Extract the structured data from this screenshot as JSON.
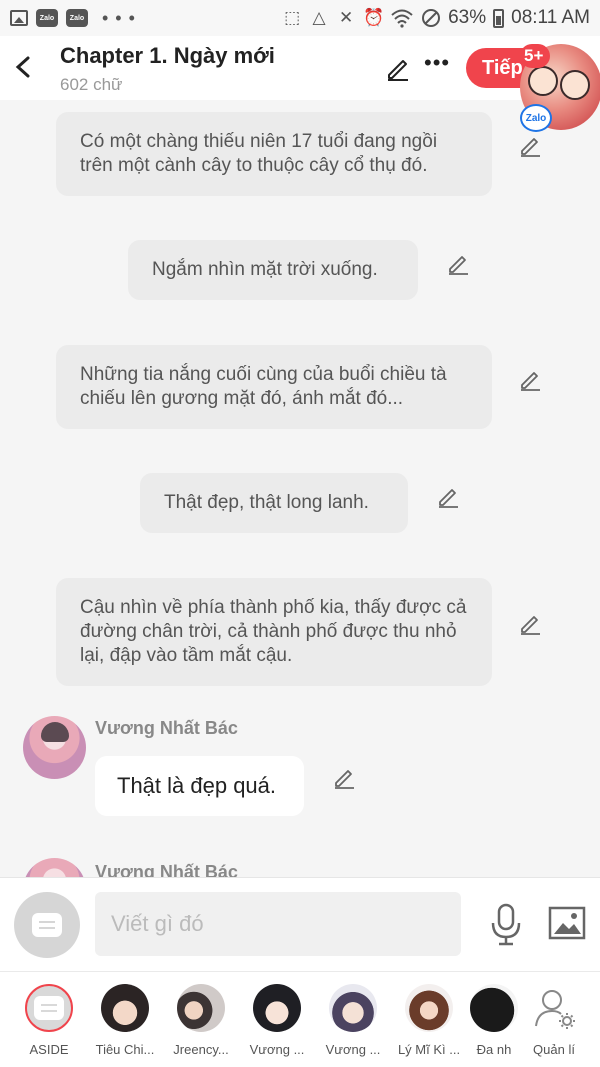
{
  "status_bar": {
    "app_icons": [
      "gallery-icon",
      "zalo-icon",
      "zalo-icon"
    ],
    "battery": "63%",
    "time": "08:11 AM"
  },
  "header": {
    "title": "Chapter 1. Ngày mới",
    "subtitle": "602 chữ",
    "next_label": "Tiếp"
  },
  "chathead": {
    "badge": "5+",
    "app_label": "Zalo"
  },
  "messages": [
    {
      "text": "Có một chàng thiếu niên 17 tuổi đang ngồi trên một cành cây to thuộc cây cổ thụ đó."
    },
    {
      "text": "Ngắm nhìn mặt trời xuống."
    },
    {
      "text": "Những tia nắng cuối cùng của buổi chiều tà chiếu lên gương mặt đó, ánh mắt đó..."
    },
    {
      "text": "Thật đẹp, thật long lanh."
    },
    {
      "text": "Cậu nhìn về phía thành phố kia, thấy được cả đường chân trời, cả thành phố được thu nhỏ lại, đập vào tầm mắt cậu."
    }
  ],
  "dialogue": [
    {
      "sender": "Vương Nhất Bác",
      "text": "Thật là đẹp quá."
    },
    {
      "sender": "Vương Nhất Bác"
    }
  ],
  "composer": {
    "placeholder": "Viết gì đó"
  },
  "characters": [
    {
      "label": "ASIDE"
    },
    {
      "label": "Tiêu Chi..."
    },
    {
      "label": "Jreency..."
    },
    {
      "label": "Vương ..."
    },
    {
      "label": "Vương ..."
    },
    {
      "label": "Lý Mĩ Kì ..."
    },
    {
      "label": "Đa nh"
    },
    {
      "label": "Quản lí"
    }
  ],
  "colors": {
    "accent": "#f0444c",
    "bubble": "#ebebeb",
    "background": "#f5f5f5"
  }
}
